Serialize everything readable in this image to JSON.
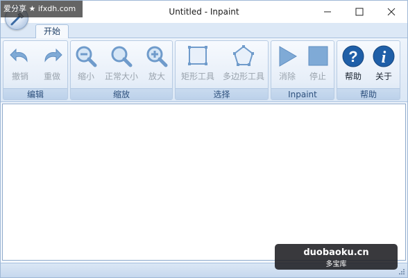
{
  "window": {
    "title": "Untitled - Inpaint"
  },
  "watermark_top": "爱分享 ★ ifxdh.com",
  "ribbon": {
    "tab": "开始",
    "groups": [
      {
        "label": "编辑",
        "buttons": [
          {
            "label": "撤销",
            "icon": "undo-icon"
          },
          {
            "label": "重做",
            "icon": "redo-icon"
          }
        ]
      },
      {
        "label": "缩放",
        "buttons": [
          {
            "label": "缩小",
            "icon": "zoom-out-icon"
          },
          {
            "label": "正常大小",
            "icon": "zoom-normal-icon"
          },
          {
            "label": "放大",
            "icon": "zoom-in-icon"
          }
        ]
      },
      {
        "label": "选择",
        "buttons": [
          {
            "label": "矩形工具",
            "icon": "rectangle-tool-icon"
          },
          {
            "label": "多边形工具",
            "icon": "polygon-tool-icon"
          }
        ]
      },
      {
        "label": "Inpaint",
        "buttons": [
          {
            "label": "消除",
            "icon": "play-icon"
          },
          {
            "label": "停止",
            "icon": "stop-icon"
          }
        ]
      },
      {
        "label": "帮助",
        "buttons": [
          {
            "label": "帮助",
            "icon": "help-icon"
          },
          {
            "label": "关于",
            "icon": "info-icon"
          }
        ]
      }
    ]
  },
  "watermark_bottom": {
    "site": "duobaoku.cn",
    "name": "多宝库"
  },
  "colors": {
    "accent": "#1f5fa8",
    "disabled_icon": "#7faad6",
    "ribbon_bg": "#dbe7f5"
  }
}
